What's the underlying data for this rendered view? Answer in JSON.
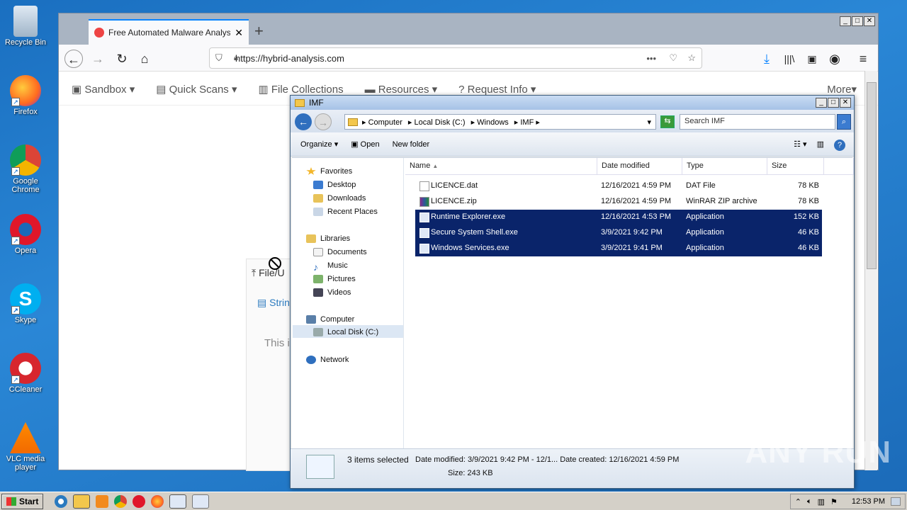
{
  "desktop": {
    "icons": [
      {
        "label": "Recycle Bin"
      },
      {
        "label": "Firefox"
      },
      {
        "label": "Google Chrome"
      },
      {
        "label": "Opera"
      },
      {
        "label": "Skype"
      },
      {
        "label": "CCleaner"
      },
      {
        "label": "VLC media player"
      }
    ]
  },
  "browser": {
    "tab_title": "Free Automated Malware Analysis",
    "url": "https://hybrid-analysis.com",
    "site_nav": [
      "Sandbox",
      "Quick Scans",
      "File Collections",
      "Resources",
      "Request Info"
    ],
    "more": "More",
    "upload_tab": "File/U",
    "strings_tab": "Strin",
    "partial_text": "This i"
  },
  "explorer": {
    "title": "IMF",
    "path": [
      "Computer",
      "Local Disk (C:)",
      "Windows",
      "IMF"
    ],
    "search_placeholder": "Search IMF",
    "toolbar": {
      "organize": "Organize",
      "open": "Open",
      "new_folder": "New folder"
    },
    "nav": {
      "favorites": "Favorites",
      "desktop": "Desktop",
      "downloads": "Downloads",
      "recent": "Recent Places",
      "libraries": "Libraries",
      "documents": "Documents",
      "music": "Music",
      "pictures": "Pictures",
      "videos": "Videos",
      "computer": "Computer",
      "local_disk": "Local Disk (C:)",
      "network": "Network"
    },
    "columns": {
      "name": "Name",
      "date": "Date modified",
      "type": "Type",
      "size": "Size"
    },
    "files": [
      {
        "name": "LICENCE.dat",
        "date": "12/16/2021 4:59 PM",
        "type": "DAT File",
        "size": "78 KB"
      },
      {
        "name": "LICENCE.zip",
        "date": "12/16/2021 4:59 PM",
        "type": "WinRAR ZIP archive",
        "size": "78 KB"
      },
      {
        "name": "Runtime Explorer.exe",
        "date": "12/16/2021 4:53 PM",
        "type": "Application",
        "size": "152 KB"
      },
      {
        "name": "Secure System Shell.exe",
        "date": "3/9/2021 9:42 PM",
        "type": "Application",
        "size": "46 KB"
      },
      {
        "name": "Windows Services.exe",
        "date": "3/9/2021 9:41 PM",
        "type": "Application",
        "size": "46 KB"
      }
    ],
    "status": {
      "count": "3 items selected",
      "modified": "Date modified: 3/9/2021 9:42 PM - 12/1...   Date created: 12/16/2021 4:59 PM",
      "size": "Size: 243 KB"
    }
  },
  "taskbar": {
    "start": "Start",
    "clock": "12:53 PM"
  },
  "watermark": "ANY RUN"
}
